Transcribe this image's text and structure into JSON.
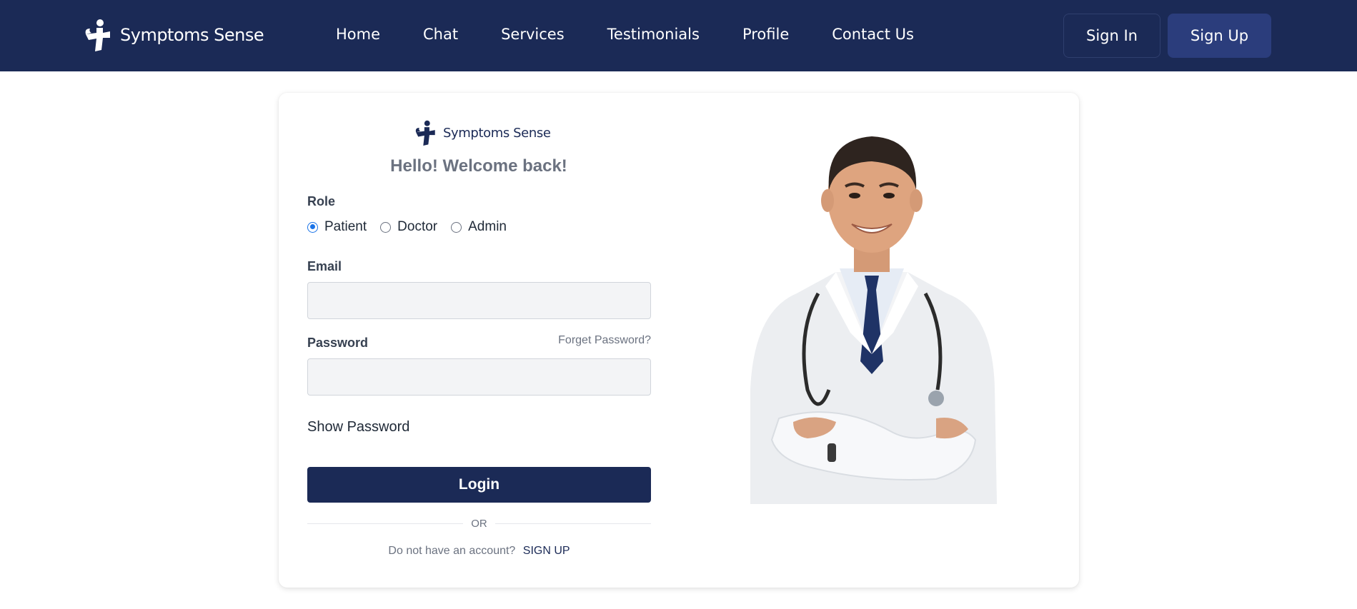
{
  "header": {
    "brand_name": "Symptoms Sense",
    "nav": [
      "Home",
      "Chat",
      "Services",
      "Testimonials",
      "Profile",
      "Contact Us"
    ],
    "sign_in_label": "Sign In",
    "sign_up_label": "Sign Up",
    "bg_color": "#1b2a56"
  },
  "login": {
    "brand_name": "Symptoms Sense",
    "welcome": "Hello! Welcome back!",
    "role_label": "Role",
    "roles": [
      "Patient",
      "Doctor",
      "Admin"
    ],
    "selected_role": "Patient",
    "email_label": "Email",
    "email_value": "",
    "password_label": "Password",
    "password_value": "",
    "forgot_label": "Forget Password?",
    "show_password_label": "Show Password",
    "login_label": "Login",
    "or_label": "OR",
    "no_account_text": "Do not have an account?",
    "signup_link": "SIGN UP",
    "accent_color": "#1b2a56"
  }
}
